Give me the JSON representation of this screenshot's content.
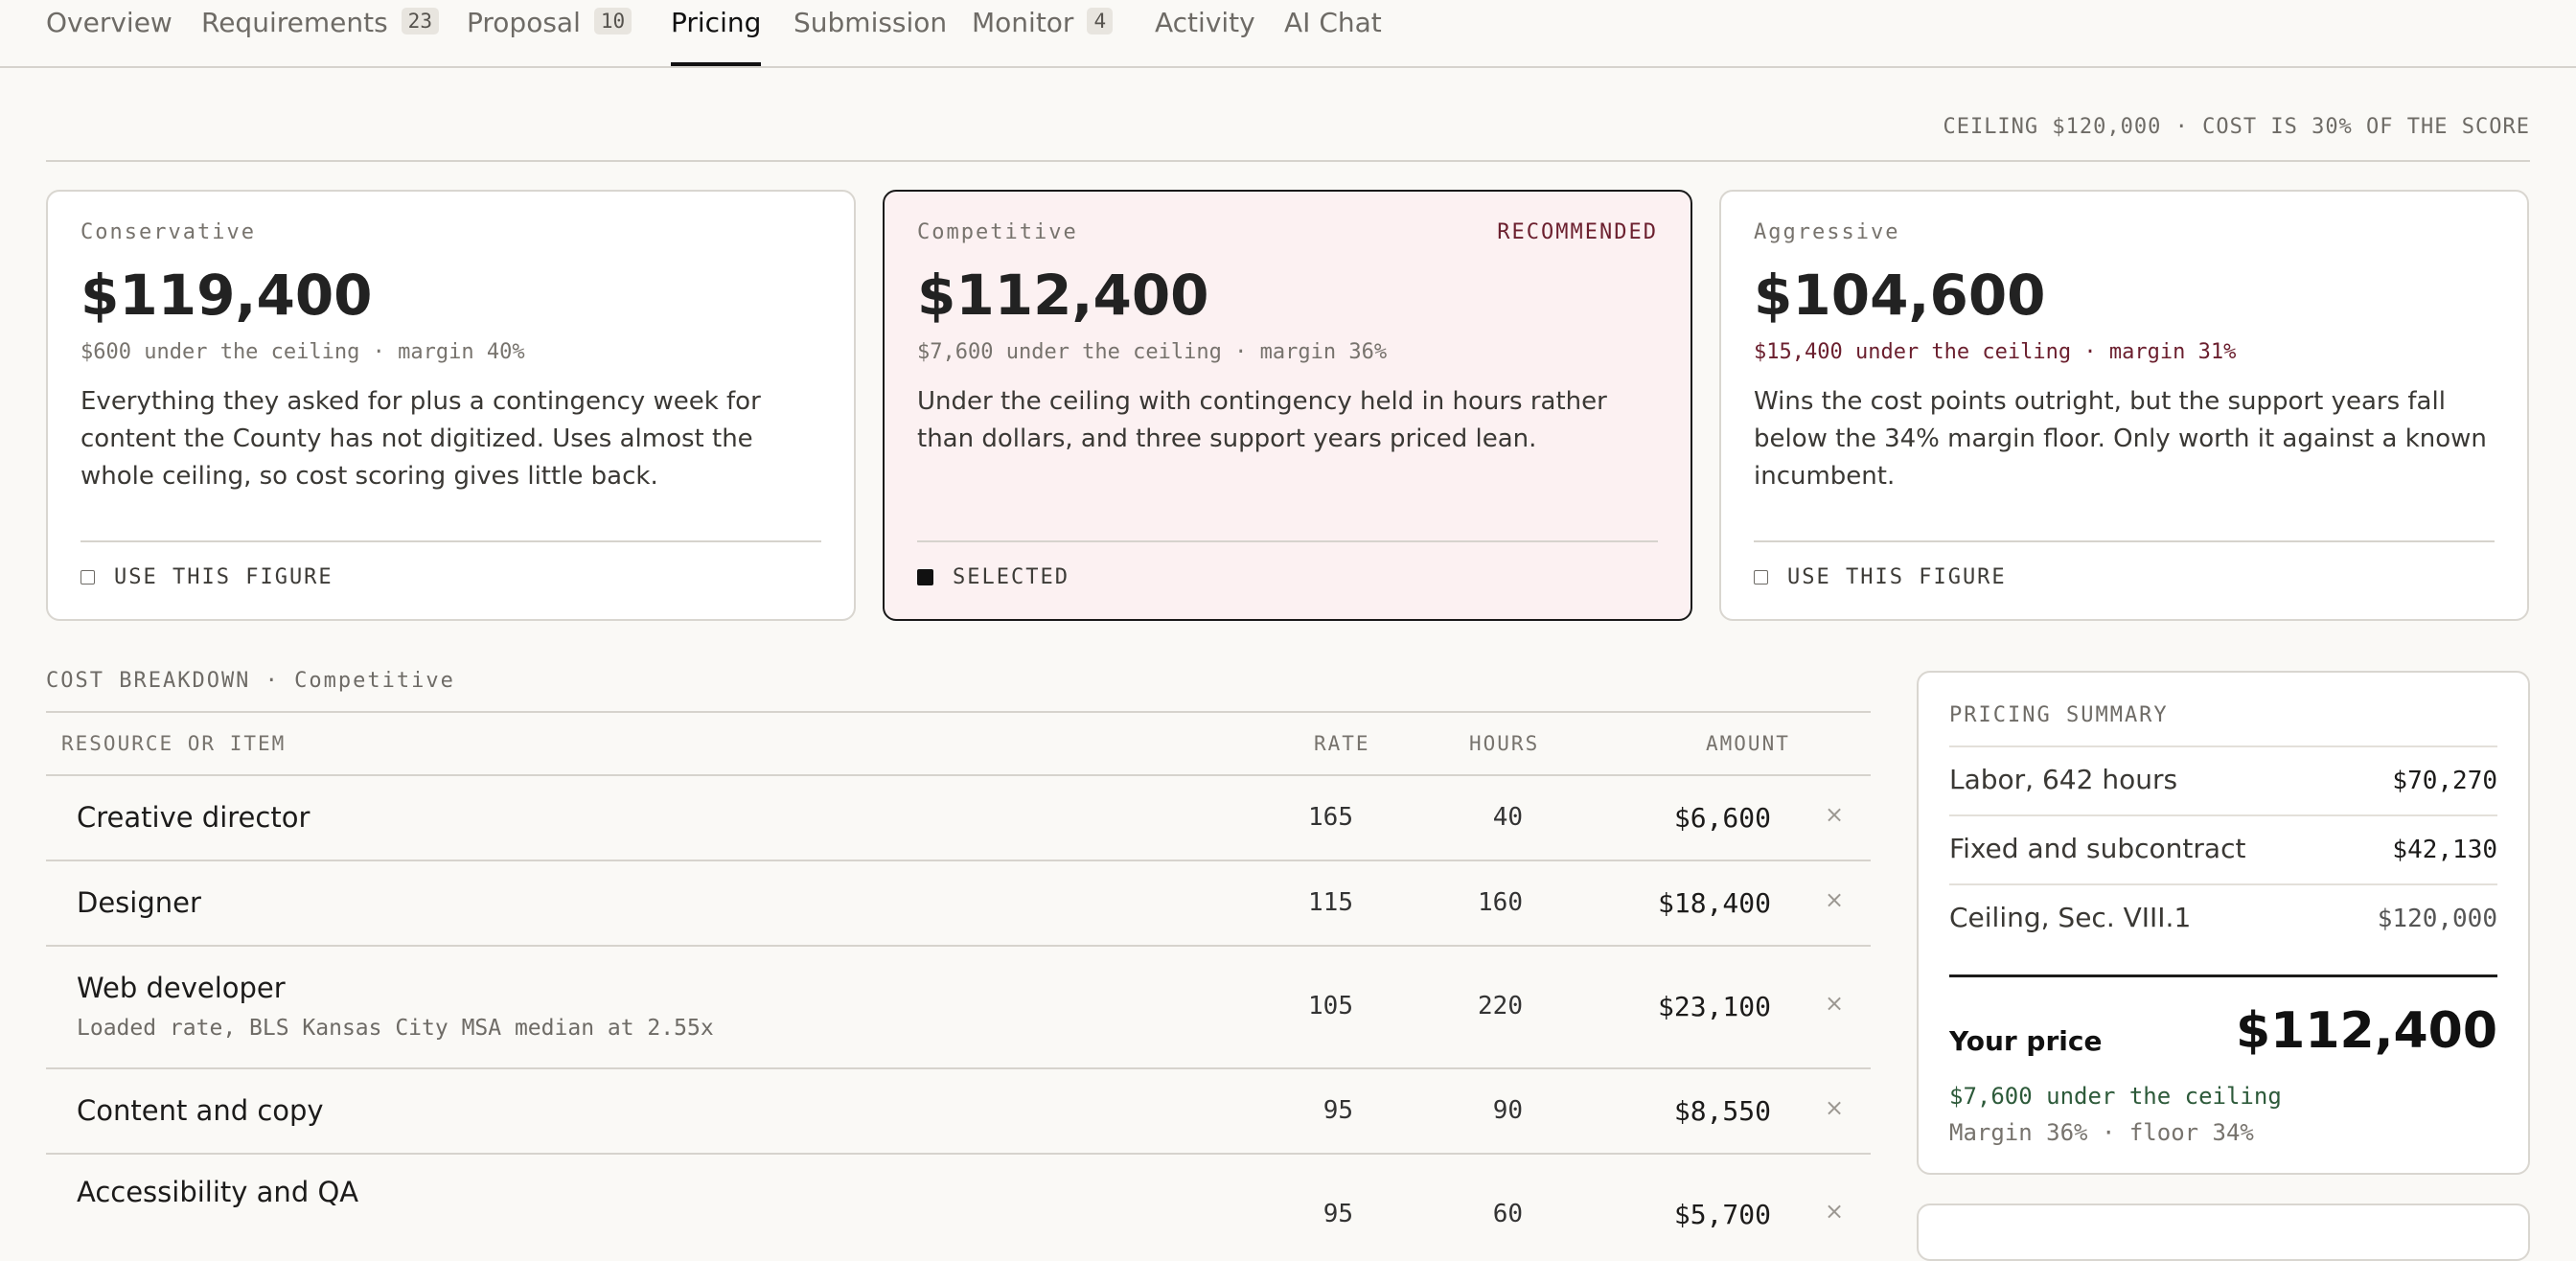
{
  "tabs": [
    {
      "label": "Overview"
    },
    {
      "label": "Requirements",
      "badge": "23"
    },
    {
      "label": "Proposal",
      "badge": "10"
    },
    {
      "label": "Pricing"
    },
    {
      "label": "Submission"
    },
    {
      "label": "Monitor",
      "badge": "4"
    },
    {
      "label": "Activity"
    },
    {
      "label": "AI Chat"
    }
  ],
  "ceiling_note": "CEILING $120,000 · COST IS 30% OF THE SCORE",
  "options": [
    {
      "label": "Conservative",
      "price": "$119,400",
      "sub": "$600 under the ceiling · margin 40%",
      "desc": "Everything they asked for plus a contingency week for content the County has not digitized. Uses almost the whole ceiling, so cost scoring gives little back.",
      "action": "USE THIS FIGURE"
    },
    {
      "label": "Competitive",
      "recommended": "RECOMMENDED",
      "price": "$112,400",
      "sub": "$7,600 under the ceiling · margin 36%",
      "desc": "Under the ceiling with contingency held in hours rather than dollars, and three support years priced lean.",
      "action": "SELECTED"
    },
    {
      "label": "Aggressive",
      "price": "$104,600",
      "sub": "$15,400 under the ceiling · margin 31%",
      "desc": "Wins the cost points outright, but the support years fall below the 34% margin floor. Only worth it against a known incumbent.",
      "action": "USE THIS FIGURE"
    }
  ],
  "breakdown": {
    "title": "COST BREAKDOWN · Competitive",
    "headers": {
      "item": "RESOURCE OR ITEM",
      "rate": "RATE",
      "hours": "HOURS",
      "amount": "AMOUNT"
    },
    "rows": [
      {
        "name": "Creative director",
        "rate": "165",
        "hours": "40",
        "amount": "$6,600"
      },
      {
        "name": "Designer",
        "rate": "115",
        "hours": "160",
        "amount": "$18,400"
      },
      {
        "name": "Web developer",
        "note": "Loaded rate, BLS Kansas City MSA median at 2.55x",
        "rate": "105",
        "hours": "220",
        "amount": "$23,100"
      },
      {
        "name": "Content and copy",
        "rate": "95",
        "hours": "90",
        "amount": "$8,550"
      },
      {
        "name": "Accessibility and QA",
        "rate": "95",
        "hours": "60",
        "amount": "$5,700"
      }
    ],
    "remove_glyph": "×"
  },
  "summary": {
    "title": "PRICING SUMMARY",
    "rows": [
      {
        "label": "Labor, 642 hours",
        "value": "$70,270"
      },
      {
        "label": "Fixed and subcontract",
        "value": "$42,130"
      },
      {
        "label": "Ceiling, Sec. VIII.1",
        "value": "$120,000"
      }
    ],
    "your_price_label": "Your price",
    "your_price": "$112,400",
    "under": "$7,600 under the ceiling",
    "margin": "Margin 36% · floor 34%"
  }
}
